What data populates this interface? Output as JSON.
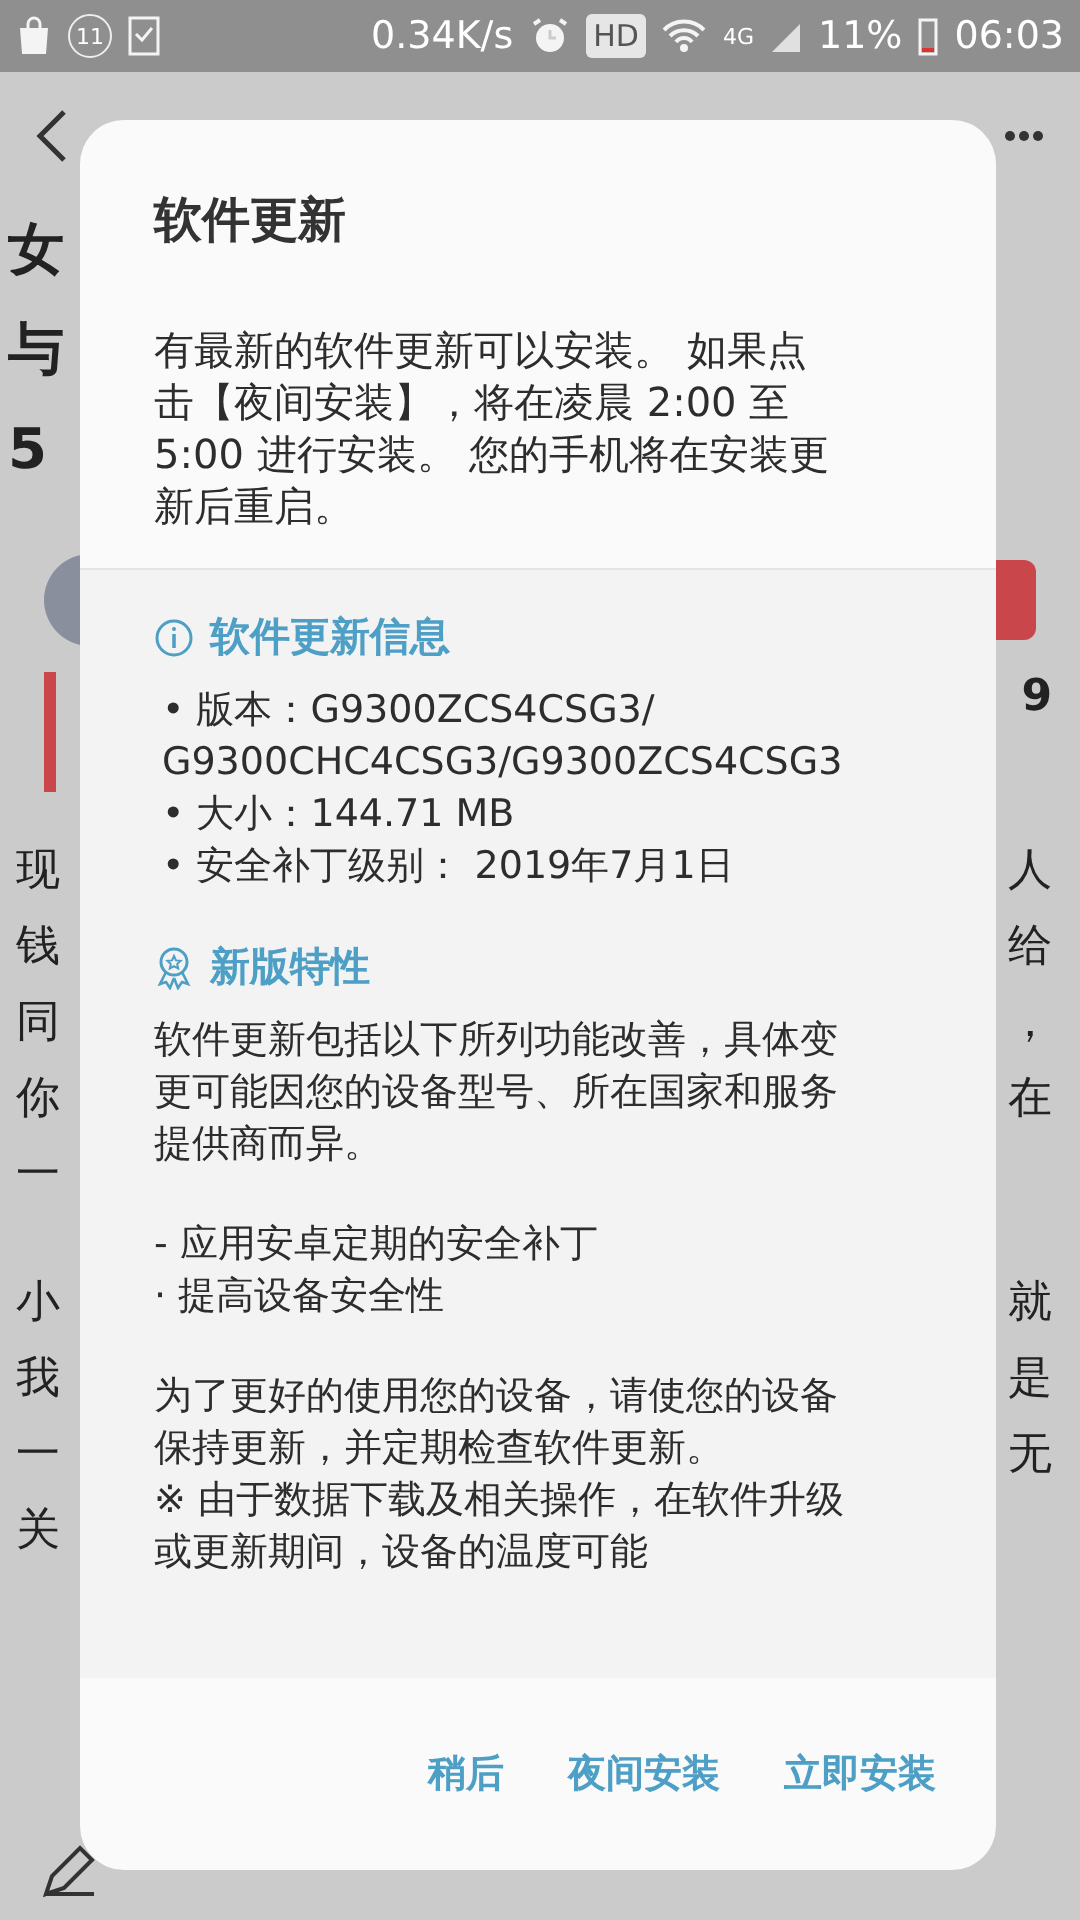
{
  "status_bar": {
    "notification_count": "11",
    "network_speed": "0.34K/s",
    "hd": "HD",
    "network_type": "4G",
    "battery": "11%",
    "time": "06:03"
  },
  "background_page": {
    "heading_fragments": [
      "女",
      "与",
      "5"
    ],
    "side_value": "9",
    "paragraphs": [
      [
        {
          "left": "现",
          "right": "人"
        },
        {
          "left": "钱",
          "right": "给"
        },
        {
          "left": "同",
          "right": "，"
        },
        {
          "left": "你",
          "right": "在"
        },
        {
          "left": "一"
        }
      ],
      [
        {
          "left": "小",
          "right": "就"
        },
        {
          "left": "我",
          "right": "是"
        },
        {
          "left": "一",
          "right": "无"
        },
        {
          "left": "关"
        }
      ]
    ]
  },
  "dialog": {
    "title": "软件更新",
    "message": "有最新的软件更新可以安装。 如果点击【夜间安装】，将在凌晨 2:00 至 5:00 进行安装。 您的手机将在安装更新后重启。",
    "info": {
      "heading": "软件更新信息",
      "items": [
        "• 版本：G9300ZCS4CSG3/ G9300CHC4CSG3/G9300ZCS4CSG3",
        "• 大小：144.71 MB",
        "• 安全补丁级别： 2019年7月1日"
      ]
    },
    "features": {
      "heading": "新版特性",
      "paragraphs": [
        "软件更新包括以下所列功能改善，具体变更可能因您的设备型号、所在国家和服务提供商而异。",
        "- 应用安卓定期的安全补丁\n · 提高设备安全性",
        "为了更好的使用您的设备，请使您的设备保持更新，并定期检查软件更新。\n※ 由于数据下载及相关操作，在软件升级或更新期间，设备的温度可能"
      ]
    },
    "buttons": [
      "稍后",
      "夜间安装",
      "立即安装"
    ]
  }
}
